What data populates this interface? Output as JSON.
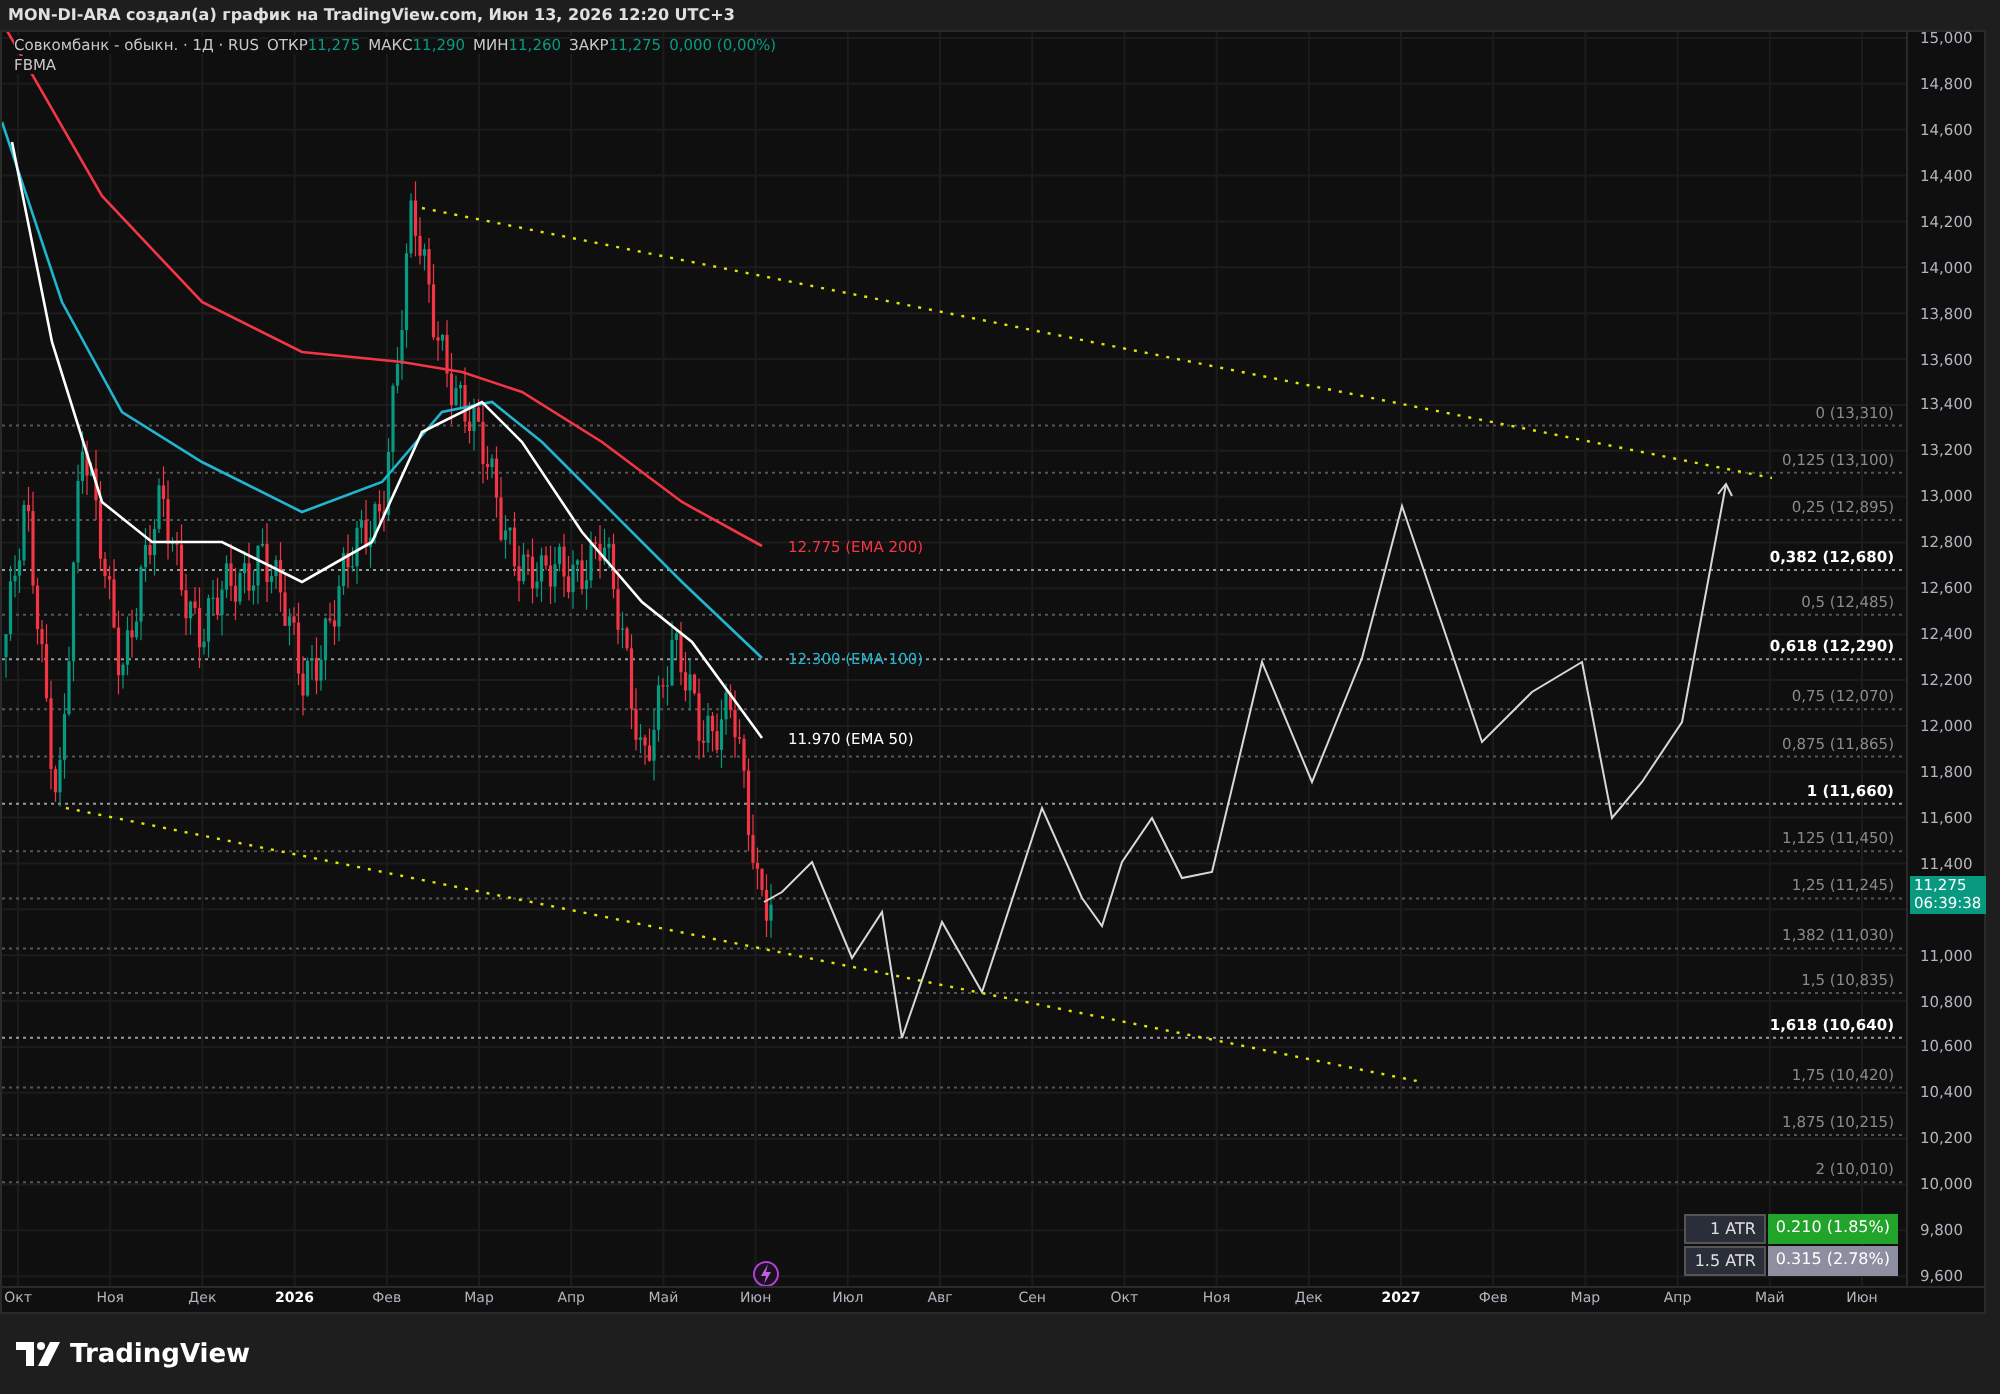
{
  "header": {
    "text": "MON-DI-ARA создал(а) график на TradingView.com, Июн 13, 2026 12:20 UTC+3"
  },
  "legend": {
    "symbol": "Совкомбанк - обыкн. · 1Д · RUS",
    "ohlc": [
      {
        "label": "ОТКР",
        "value": "11,275"
      },
      {
        "label": "МАКС",
        "value": "11,290"
      },
      {
        "label": "МИН",
        "value": "11,260"
      },
      {
        "label": "ЗАКР",
        "value": "11,275"
      }
    ],
    "change": "0,000 (0,00%)",
    "indicator": "FBMA"
  },
  "chart": {
    "price_ticks": [
      "15,000",
      "14,800",
      "14,600",
      "14,400",
      "14,200",
      "14,000",
      "13,800",
      "13,600",
      "13,400",
      "13,200",
      "13,000",
      "12,800",
      "12,600",
      "12,400",
      "12,200",
      "12,000",
      "11,800",
      "11,600",
      "11,400",
      "11,000",
      "10,800",
      "10,600",
      "10,400",
      "10,200",
      "10,000",
      "9,800",
      "9,600"
    ],
    "time_ticks": [
      {
        "label": "Окт",
        "bold": false
      },
      {
        "label": "Ноя",
        "bold": false
      },
      {
        "label": "Дек",
        "bold": false
      },
      {
        "label": "2026",
        "bold": true
      },
      {
        "label": "Фев",
        "bold": false
      },
      {
        "label": "Мар",
        "bold": false
      },
      {
        "label": "Апр",
        "bold": false
      },
      {
        "label": "Май",
        "bold": false
      },
      {
        "label": "Июн",
        "bold": false
      },
      {
        "label": "Июл",
        "bold": false
      },
      {
        "label": "Авг",
        "bold": false
      },
      {
        "label": "Сен",
        "bold": false
      },
      {
        "label": "Окт",
        "bold": false
      },
      {
        "label": "Ноя",
        "bold": false
      },
      {
        "label": "Дек",
        "bold": false
      },
      {
        "label": "2027",
        "bold": true
      },
      {
        "label": "Фев",
        "bold": false
      },
      {
        "label": "Мар",
        "bold": false
      },
      {
        "label": "Апр",
        "bold": false
      },
      {
        "label": "Май",
        "bold": false
      },
      {
        "label": "Июн",
        "bold": false
      }
    ],
    "fib_levels": [
      {
        "label": "0 (13,310)",
        "emphasized": false
      },
      {
        "label": "0,125 (13,100)",
        "emphasized": false
      },
      {
        "label": "0,25 (12,895)",
        "emphasized": false
      },
      {
        "label": "0,382 (12,680)",
        "emphasized": true
      },
      {
        "label": "0,5 (12,485)",
        "emphasized": false
      },
      {
        "label": "0,618 (12,290)",
        "emphasized": true
      },
      {
        "label": "0,75 (12,070)",
        "emphasized": false
      },
      {
        "label": "0,875 (11,865)",
        "emphasized": false
      },
      {
        "label": "1 (11,660)",
        "emphasized": true
      },
      {
        "label": "1,125 (11,450)",
        "emphasized": false
      },
      {
        "label": "1,25 (11,245)",
        "emphasized": false
      },
      {
        "label": "1,382 (11,030)",
        "emphasized": false
      },
      {
        "label": "1,5 (10,835)",
        "emphasized": false
      },
      {
        "label": "1,618 (10,640)",
        "emphasized": true
      },
      {
        "label": "1,75 (10,420)",
        "emphasized": false
      },
      {
        "label": "1,875 (10,215)",
        "emphasized": false
      },
      {
        "label": "2 (10,010)",
        "emphasized": false
      }
    ],
    "ema_labels": [
      {
        "text": "12.775 (EMA 200)",
        "color": "#f23645"
      },
      {
        "text": "12.300 (EMA 100)",
        "color": "#22b5d0"
      },
      {
        "text": "11.970 (EMA 50)",
        "color": "#ffffff"
      }
    ],
    "last_price": {
      "price": "11,275",
      "countdown": "06:39:38"
    }
  },
  "atr_table": [
    {
      "label": "1 ATR",
      "value": "0.210 (1.85%)",
      "kind": "up"
    },
    {
      "label": "1.5 ATR",
      "value": "0.315 (2.78%)",
      "kind": "neutral"
    }
  ],
  "footer": {
    "brand": "TradingView"
  }
}
